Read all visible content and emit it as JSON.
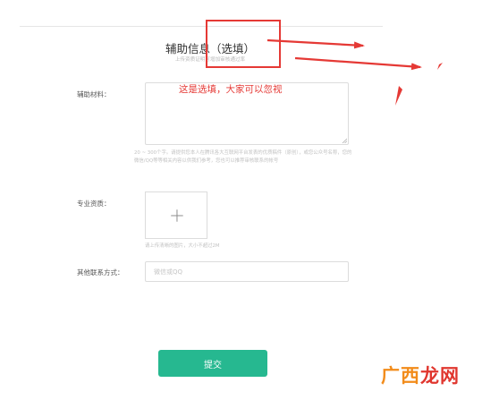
{
  "form": {
    "title": "辅助信息（选填）",
    "subtitle": "上传资质证明可增加审核通过率",
    "annotation": "这是选填，大家可以忽视",
    "materials": {
      "label": "辅助材料：",
      "help": "20 ~ 300个字。请提供您本人在腾讯各大互联网平台发表的优质稿件（原创），或您公众号名称，您的微信/QQ等等相关内容以供我们参考，您也可以推荐审核联系的帐号"
    },
    "qualification": {
      "label": "专业资质：",
      "help": "请上传清晰的图片，大小不超过2M"
    },
    "contact": {
      "label": "其他联系方式：",
      "placeholder": "微信或QQ"
    },
    "submit_label": "提交"
  },
  "watermark": {
    "part1": "广西",
    "part2": "龙网"
  },
  "colors": {
    "accent": "#26b890",
    "annotation": "#e53935"
  },
  "icons": {
    "upload": "plus-icon"
  }
}
